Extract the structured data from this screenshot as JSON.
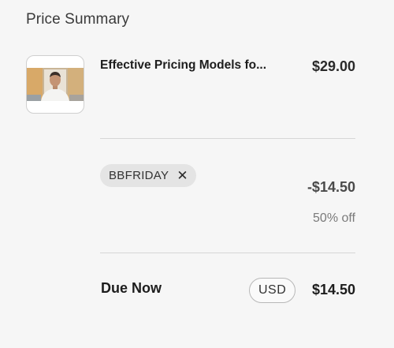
{
  "summary": {
    "title": "Price Summary"
  },
  "product": {
    "name": "Effective Pricing Models fo...",
    "price": "$29.00",
    "thumbnail_icon": "instructor-portrait-icon"
  },
  "coupon": {
    "code": "BBFRIDAY",
    "remove_icon": "✕",
    "discount_amount": "-$14.50",
    "discount_percent": "50% off"
  },
  "total": {
    "label": "Due Now",
    "currency": "USD",
    "amount": "$14.50"
  }
}
